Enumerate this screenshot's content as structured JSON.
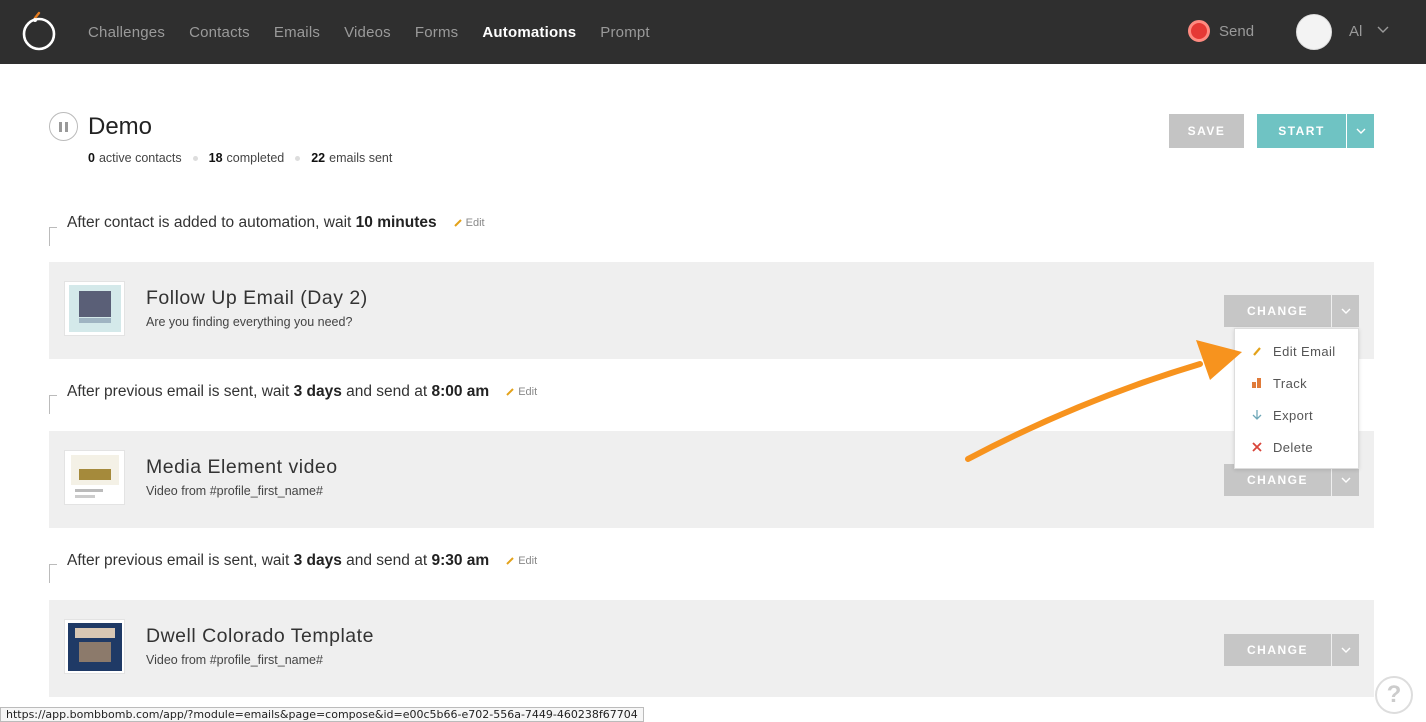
{
  "nav": {
    "items": [
      "Challenges",
      "Contacts",
      "Emails",
      "Videos",
      "Forms",
      "Automations",
      "Prompt"
    ],
    "active": "Automations",
    "send_label": "Send",
    "user_name": "Al"
  },
  "header": {
    "title": "Demo",
    "stats": [
      {
        "value": "0",
        "label": "active contacts"
      },
      {
        "value": "18",
        "label": "completed"
      },
      {
        "value": "22",
        "label": "emails sent"
      }
    ],
    "save_label": "SAVE",
    "start_label": "START"
  },
  "waits": [
    {
      "pre": "After contact is added to automation, wait ",
      "duration": "10 minutes",
      "mid": "",
      "time": "",
      "edit": "Edit"
    },
    {
      "pre": "After previous email is sent, wait ",
      "duration": "3 days",
      "mid": " and send at ",
      "time": "8:00 am",
      "edit": "Edit"
    },
    {
      "pre": "After previous email is sent, wait ",
      "duration": "3 days",
      "mid": " and send at ",
      "time": "9:30 am",
      "edit": "Edit"
    }
  ],
  "emails": [
    {
      "title": "Follow Up Email (Day 2)",
      "subtitle": "Are you finding everything you need?",
      "change": "CHANGE"
    },
    {
      "title": "Media Element video",
      "subtitle": "Video from #profile_first_name#",
      "change": "CHANGE"
    },
    {
      "title": "Dwell Colorado Template",
      "subtitle": "Video from #profile_first_name#",
      "change": "CHANGE"
    }
  ],
  "dropdown": {
    "items": [
      {
        "label": "Edit Email",
        "icon": "pencil-icon"
      },
      {
        "label": "Track",
        "icon": "bar-chart-icon"
      },
      {
        "label": "Export",
        "icon": "download-arrow-icon"
      },
      {
        "label": "Delete",
        "icon": "x-icon"
      }
    ]
  },
  "statusbar": {
    "url": "https://app.bombbomb.com/app/?module=emails&page=compose&id=e00c5b66-e702-556a-7449-460238f67704"
  },
  "help_label": "?",
  "colors": {
    "topbar": "#2f2f2f",
    "accent_teal": "#6fc3c3",
    "record_red": "#e53935",
    "annotation_orange": "#f7931e",
    "card_bg": "#efefef"
  }
}
